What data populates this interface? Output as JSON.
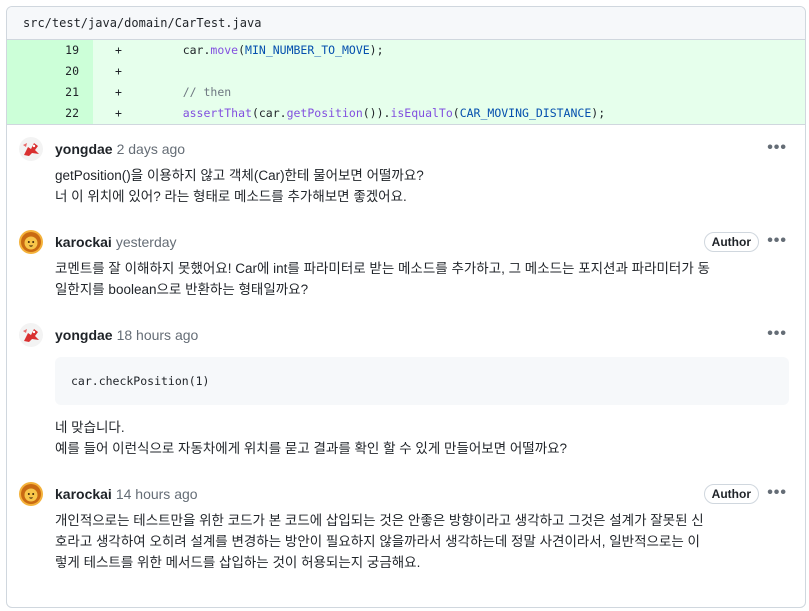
{
  "file": {
    "path": "src/test/java/domain/CarTest.java"
  },
  "diff_lines": [
    {
      "num": "19",
      "sign": "+",
      "indent": "    ",
      "parts": [
        {
          "t": "car.",
          "c": ""
        },
        {
          "t": "move",
          "c": "fn"
        },
        {
          "t": "(",
          "c": ""
        },
        {
          "t": "MIN_NUMBER_TO_MOVE",
          "c": "cst"
        },
        {
          "t": ");",
          "c": ""
        }
      ]
    },
    {
      "num": "20",
      "sign": "+",
      "indent": "",
      "parts": []
    },
    {
      "num": "21",
      "sign": "+",
      "indent": "    ",
      "parts": [
        {
          "t": "// then",
          "c": "cmt"
        }
      ]
    },
    {
      "num": "22",
      "sign": "+",
      "indent": "    ",
      "parts": [
        {
          "t": "assertThat",
          "c": "fn"
        },
        {
          "t": "(car.",
          "c": ""
        },
        {
          "t": "getPosition",
          "c": "fn"
        },
        {
          "t": "()).",
          "c": ""
        },
        {
          "t": "isEqualTo",
          "c": "fn"
        },
        {
          "t": "(",
          "c": ""
        },
        {
          "t": "CAR_MOVING_DISTANCE",
          "c": "cst"
        },
        {
          "t": ");",
          "c": ""
        }
      ]
    }
  ],
  "comments": [
    {
      "author": "yongdae",
      "time": "2 days ago",
      "badge": "",
      "avatar": "red-dragon",
      "snippet": "",
      "lines": [
        "getPosition()을 이용하지 않고 객체(Car)한테 물어보면 어떨까요?",
        "너 이 위치에 있어? 라는 형태로 메소드를 추가해보면 좋겠어요."
      ]
    },
    {
      "author": "karockai",
      "time": "yesterday",
      "badge": "Author",
      "avatar": "lion",
      "snippet": "",
      "lines": [
        "코멘트를 잘 이해하지 못했어요! Car에 int를 파라미터로 받는 메소드를 추가하고, 그 메소드는 포지션과 파라미터가 동",
        "일한지를 boolean으로 반환하는 형태일까요?"
      ]
    },
    {
      "author": "yongdae",
      "time": "18 hours ago",
      "badge": "",
      "avatar": "red-dragon",
      "snippet": "car.checkPosition(1)",
      "lines": [
        "네 맞습니다.",
        "예를 들어 이런식으로 자동차에게 위치를 묻고 결과를 확인 할 수 있게 만들어보면 어떨까요?"
      ]
    },
    {
      "author": "karockai",
      "time": "14 hours ago",
      "badge": "Author",
      "avatar": "lion",
      "snippet": "",
      "lines": [
        "개인적으로는 테스트만을 위한 코드가 본 코드에 삽입되는 것은 안좋은 방향이라고 생각하고 그것은 설계가 잘못된 신",
        "호라고 생각하여 오히려 설계를 변경하는 방안이 필요하지 않을까라서 생각하는데 정말 사견이라서, 일반적으로는 이",
        "렇게 테스트를 위한 메서드를 삽입하는 것이 허용되는지 궁금해요."
      ]
    }
  ],
  "menu_glyph": "•••"
}
